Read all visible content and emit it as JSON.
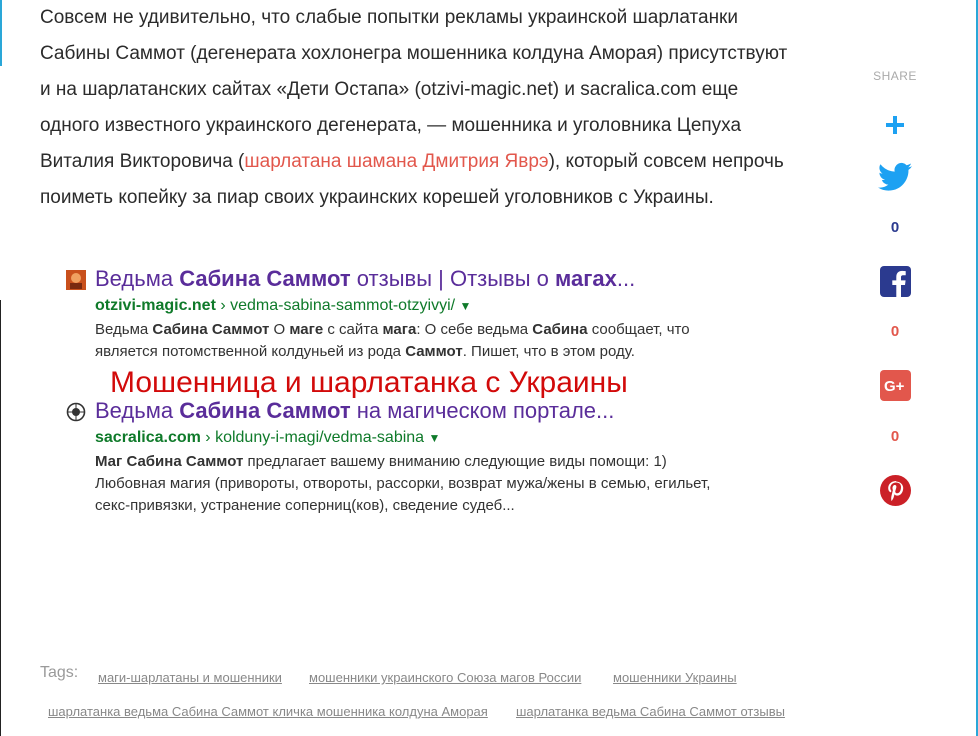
{
  "article": {
    "line1": "Совсем не удивительно, что слабые попытки рекламы украинской шарлатанки",
    "line2": "Сабины Саммот (дегенерата хохлонегра мошенника колдуна Аморая) присутствуют",
    "line3": "и на шарлатанских сайтах «Дети Остапа» (otzivi-magic.net) и sacralica.com еще",
    "line4": "одного известного украинского дегенерата, — мошенника и уголовника Цепуха",
    "line5_pre": "Виталия Викторовича (",
    "line5_link": "шарлатана шамана Дмитрия Яврэ",
    "line5_post": "), который совсем непрочь",
    "line6": "поиметь копейку за пиар своих украинских корешей уголовников с Украины."
  },
  "serp": {
    "overlay_caption": "Мошенница и шарлатанка с Украины",
    "results": [
      {
        "title_a": "Ведьма ",
        "title_b": "Сабина Саммот",
        "title_c": " отзывы | Отзывы о ",
        "title_d": "магах",
        "title_e": "...",
        "domain": "otzivi-magic.net",
        "path": " › vedma-sabina-sammot-otzyivyi/",
        "caret": "▼",
        "snip1_a": "Ведьма ",
        "snip1_b": "Сабина Саммот",
        "snip1_c": " О ",
        "snip1_d": "маге",
        "snip1_e": " с сайта ",
        "snip1_f": "мага",
        "snip1_g": ": О себе ведьма ",
        "snip1_h": "Сабина",
        "snip1_i": " сообщает, что",
        "snip2_a": "является потомственной колдуньей из рода ",
        "snip2_b": "Саммот",
        "snip2_c": ". Пишет, что в этом роду."
      },
      {
        "title_a": "Ведьма ",
        "title_b": "Сабина Саммот",
        "title_c": " на магическом портале...",
        "domain": "sacralica.com",
        "path": " › kolduny-i-magi/vedma-sabina",
        "caret": "▼",
        "snip1_a": "Маг ",
        "snip1_b": "Сабина Саммот",
        "snip1_c": " предлагает вашему вниманию следующие виды помощи: 1)",
        "snip2": "Любовная магия (привороты, отвороты, рассорки, возврат мужа/жены в семью, егильет,",
        "snip3": "секс-привязки, устранение соперниц(ков), сведение судеб..."
      }
    ]
  },
  "share": {
    "label": "SHARE",
    "twitter_count": "0",
    "facebook_count": "0",
    "googleplus_count": "0",
    "colors": {
      "blue": "#1da1f2",
      "navy": "#2b3a8f",
      "red": "#e2574c",
      "pinterest": "#cb2027",
      "gray": "#aaaaaa"
    },
    "icons": [
      "plus-icon",
      "twitter-icon",
      "facebook-icon",
      "google-plus-icon",
      "pinterest-icon"
    ]
  },
  "tags": {
    "label": "Tags:",
    "items": [
      "маги-шарлатаны и мошенники",
      "мошенники украинского Союза магов России",
      "мошенники Украины",
      "шарлатанка ведьма Сабина Саммот кличка мошенника колдуна Аморая",
      "шарлатанка ведьма Сабина Саммот отзывы"
    ]
  }
}
